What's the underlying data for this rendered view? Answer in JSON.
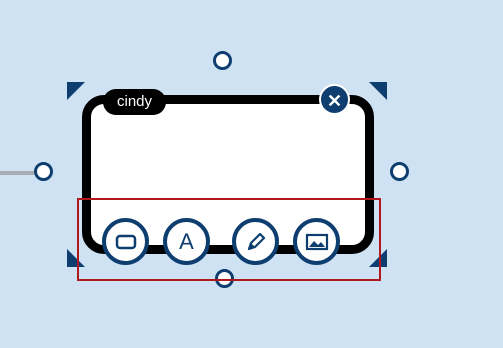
{
  "node": {
    "name": "cindy",
    "close_icon": "close-icon"
  },
  "toolbar": {
    "tools": [
      "shape-tool",
      "text-tool",
      "pencil-tool",
      "image-tool"
    ],
    "text_tool_glyph": "A"
  },
  "colors": {
    "background": "#cfe2f3",
    "accent": "#0d3e6f",
    "border": "#000000",
    "highlight": "#b0181e"
  }
}
